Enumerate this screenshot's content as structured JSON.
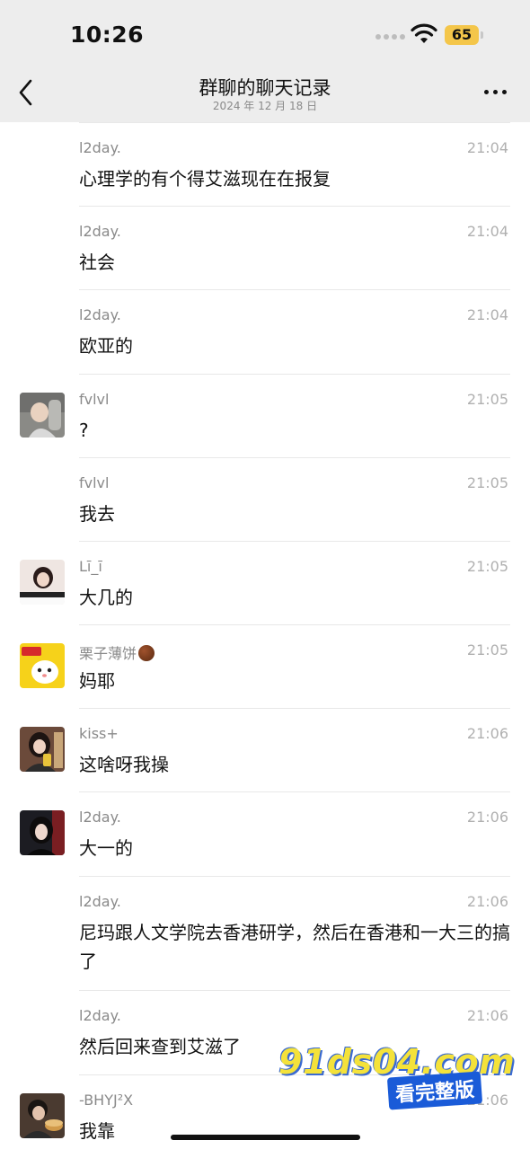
{
  "status_bar": {
    "time": "10:26",
    "battery": "65"
  },
  "header": {
    "title": "群聊的聊天记录",
    "subtitle": "2024 年 12 月 18 日"
  },
  "colors": {
    "nav_bg": "#ededed",
    "battery": "#f4c64a",
    "watermark_yellow": "#f4e23a",
    "watermark_blue": "#1a5bd8"
  },
  "messages": [
    {
      "name": "l2day.",
      "time": "21:04",
      "text": "心理学的有个得艾滋现在在报复",
      "avatar": ""
    },
    {
      "name": "l2day.",
      "time": "21:04",
      "text": "社会",
      "avatar": ""
    },
    {
      "name": "l2day.",
      "time": "21:04",
      "text": "欧亚的",
      "avatar": ""
    },
    {
      "name": "fvlvl",
      "time": "21:05",
      "text": "?",
      "avatar": "child-avatar"
    },
    {
      "name": "fvlvl",
      "time": "21:05",
      "text": "我去",
      "avatar": ""
    },
    {
      "name": "Lī_ī",
      "time": "21:05",
      "text": "大几的",
      "avatar": "girl-piano-avatar"
    },
    {
      "name": "栗子薄饼",
      "time": "21:05",
      "text": "妈耶",
      "avatar": "cartoon-cat-avatar",
      "badge_icon": "chestnut-icon"
    },
    {
      "name": "kiss+",
      "time": "21:06",
      "text": "这啥呀我操",
      "avatar": "girl-drink-avatar"
    },
    {
      "name": "l2day.",
      "time": "21:06",
      "text": "大一的",
      "avatar": "girl-dark-avatar"
    },
    {
      "name": "l2day.",
      "time": "21:06",
      "text": "尼玛跟人文学院去香港研学，然后在香港和一大三的搞了",
      "avatar": ""
    },
    {
      "name": "l2day.",
      "time": "21:06",
      "text": "然后回来查到艾滋了",
      "avatar": ""
    },
    {
      "name": "-BHYJ²X",
      "time": "21:06",
      "text": "我靠",
      "avatar": "boy-food-avatar"
    }
  ],
  "watermark": {
    "site": "91ds04.com",
    "tag": "看完整版"
  }
}
